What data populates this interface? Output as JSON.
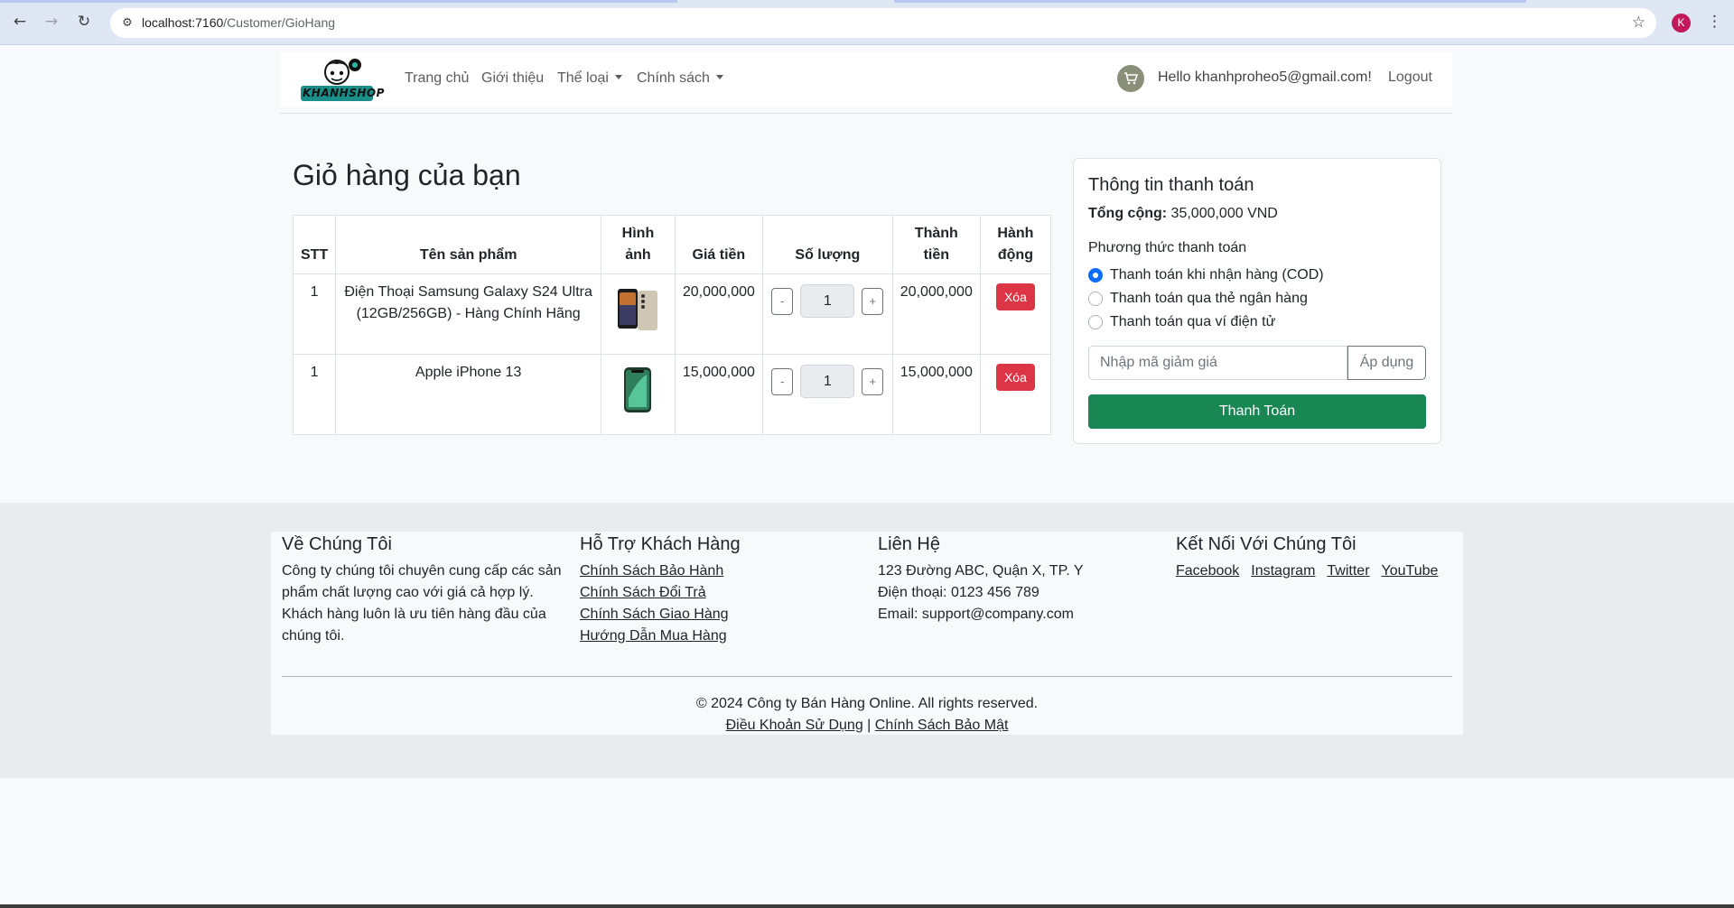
{
  "browser": {
    "url_host": "localhost:7160",
    "url_path": "/Customer/GioHang",
    "profile_initial": "K"
  },
  "navbar": {
    "logo_text": "KHANHSHOP",
    "links": [
      "Trang chủ",
      "Giới thiệu"
    ],
    "dropdowns": [
      "Thể loại",
      "Chính sách"
    ],
    "greeting": "Hello khanhproheo5@gmail.com!",
    "logout": "Logout"
  },
  "cart": {
    "title": "Giỏ hàng của bạn",
    "headers": {
      "stt": "STT",
      "name": "Tên sản phẩm",
      "image": "Hình ảnh",
      "price": "Giá tiền",
      "qty": "Số lượng",
      "total": "Thành tiền",
      "action": "Hành động"
    },
    "rows": [
      {
        "stt": "1",
        "name": "Điện Thoại Samsung Galaxy S24 Ultra (12GB/256GB) - Hàng Chính Hãng",
        "price": "20,000,000",
        "qty": "1",
        "total": "20,000,000",
        "delete": "Xóa",
        "minus": "-",
        "plus": "+"
      },
      {
        "stt": "1",
        "name": "Apple iPhone 13",
        "price": "15,000,000",
        "qty": "1",
        "total": "15,000,000",
        "delete": "Xóa",
        "minus": "-",
        "plus": "+"
      }
    ]
  },
  "payment": {
    "title": "Thông tin thanh toán",
    "total_label": "Tổng cộng:",
    "total_value": "35,000,000 VND",
    "method_label": "Phương thức thanh toán",
    "methods": [
      "Thanh toán khi nhận hàng (COD)",
      "Thanh toán qua thẻ ngân hàng",
      "Thanh toán qua ví điện tử"
    ],
    "selected_method": 0,
    "coupon_placeholder": "Nhập mã giảm giá",
    "apply_button": "Áp dụng",
    "checkout_button": "Thanh Toán"
  },
  "footer": {
    "about": {
      "title": "Về Chúng Tôi",
      "text": "Công ty chúng tôi chuyên cung cấp các sản phẩm chất lượng cao với giá cả hợp lý. Khách hàng luôn là ưu tiên hàng đầu của chúng tôi."
    },
    "support": {
      "title": "Hỗ Trợ Khách Hàng",
      "links": [
        "Chính Sách Bảo Hành",
        "Chính Sách Đổi Trả",
        "Chính Sách Giao Hàng",
        "Hướng Dẫn Mua Hàng"
      ]
    },
    "contact": {
      "title": "Liên Hệ",
      "lines": [
        "123 Đường ABC, Quận X, TP. Y",
        "Điện thoại: 0123 456 789",
        "Email: support@company.com"
      ]
    },
    "social": {
      "title": "Kết Nối Với Chúng Tôi",
      "links": [
        "Facebook",
        "Instagram",
        "Twitter",
        "YouTube"
      ]
    },
    "copyright": "© 2024 Công ty Bán Hàng Online. All rights reserved.",
    "terms": "Điều Khoản Sử Dụng",
    "separator": "|",
    "privacy": "Chính Sách Bảo Mật"
  },
  "colors": {
    "danger": "#dc3545",
    "success": "#198754",
    "primary": "#0d6efd"
  }
}
